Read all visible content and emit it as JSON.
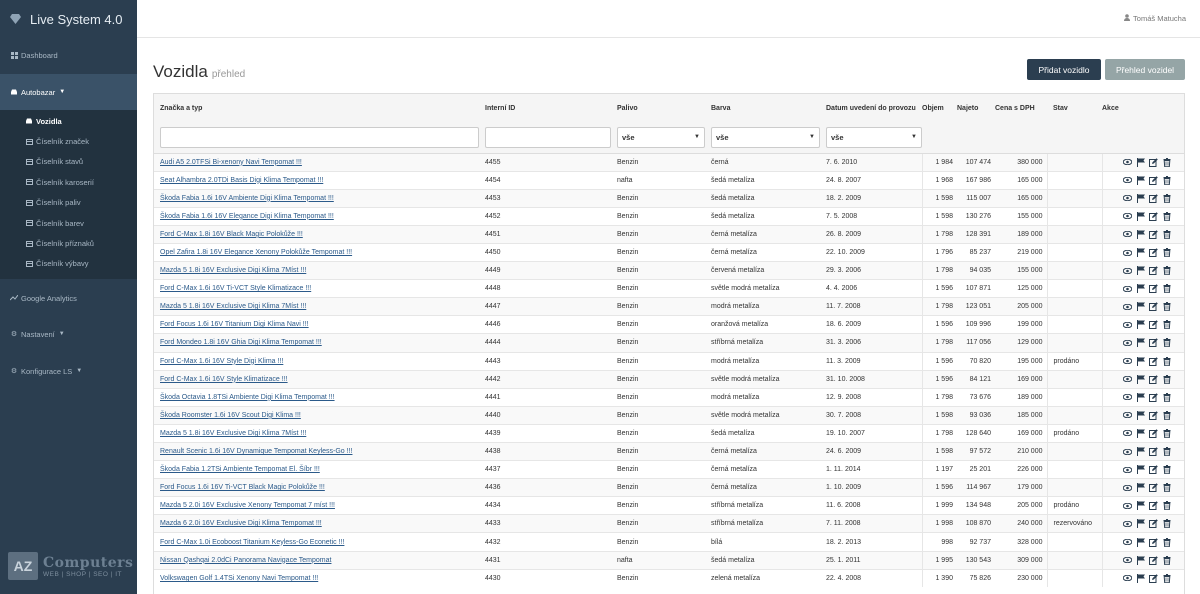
{
  "app": {
    "title": "Live System 4.0"
  },
  "sidebar": {
    "items": [
      {
        "label": "Dashboard",
        "icon": "dashboard-icon"
      },
      {
        "label": "Autobazar",
        "icon": "car-icon"
      },
      {
        "label": "Google Analytics",
        "icon": "chart-icon"
      },
      {
        "label": "Nastavení",
        "icon": "gears-icon"
      },
      {
        "label": "Konfigurace LS",
        "icon": "gear-icon"
      }
    ],
    "submenu": [
      {
        "label": "Vozidla",
        "icon": "car-icon"
      },
      {
        "label": "Číselník značek",
        "icon": "table-icon"
      },
      {
        "label": "Číselník stavů",
        "icon": "table-icon"
      },
      {
        "label": "Číselník karoserií",
        "icon": "table-icon"
      },
      {
        "label": "Číselník paliv",
        "icon": "table-icon"
      },
      {
        "label": "Číselník barev",
        "icon": "table-icon"
      },
      {
        "label": "Číselník příznaků",
        "icon": "table-icon"
      },
      {
        "label": "Číselník výbavy",
        "icon": "table-icon"
      }
    ],
    "logo": {
      "box": "AZ",
      "title": "Computers",
      "sub": "WEB | SHOP | SEO | IT"
    }
  },
  "topbar": {
    "user": "Tomáš Matucha"
  },
  "header": {
    "title": "Vozidla",
    "subtitle": "přehled",
    "add_label": "Přidat vozidlo",
    "view_label": "Přehled vozidel"
  },
  "table": {
    "columns": [
      "Značka a typ",
      "Interní ID",
      "Palivo",
      "Barva",
      "Datum uvedení do provozu",
      "Objem",
      "Najeto",
      "Cena s DPH",
      "Stav",
      "Akce"
    ],
    "filters": {
      "palivo": "vše",
      "barva": "vše",
      "datum": "vše"
    },
    "rows": [
      [
        "Audi A5 2.0TFSi Bi-xenony Navi Tempomat !!!",
        "4455",
        "Benzin",
        "černá",
        "7. 6. 2010",
        "1 984",
        "107 474",
        "380 000",
        ""
      ],
      [
        "Seat Alhambra 2.0TDi Basis Digi Klima Tempomat !!!",
        "4454",
        "nafta",
        "šedá metalíza",
        "24. 8. 2007",
        "1 968",
        "167 986",
        "165 000",
        ""
      ],
      [
        "Škoda Fabia 1.6i 16V Ambiente Digi Klima Tempomat !!!",
        "4453",
        "Benzin",
        "šedá metalíza",
        "18. 2. 2009",
        "1 598",
        "115 007",
        "165 000",
        ""
      ],
      [
        "Škoda Fabia 1.6i 16V Elegance Digi Klima Tempomat !!!",
        "4452",
        "Benzin",
        "šedá metalíza",
        "7. 5. 2008",
        "1 598",
        "130 276",
        "155 000",
        ""
      ],
      [
        "Ford C-Max 1.8i 16V Black Magic Polokůže !!!",
        "4451",
        "Benzin",
        "černá metalíza",
        "26. 8. 2009",
        "1 798",
        "128 391",
        "189 000",
        ""
      ],
      [
        "Opel Zafira 1.8i 16V Elegance Xenony Polokůže Tempomat !!!",
        "4450",
        "Benzin",
        "černá metalíza",
        "22. 10. 2009",
        "1 796",
        "85 237",
        "219 000",
        ""
      ],
      [
        "Mazda 5 1.8i 16V Exclusive Digi Klima 7Míst !!!",
        "4449",
        "Benzin",
        "červená metalíza",
        "29. 3. 2006",
        "1 798",
        "94 035",
        "155 000",
        ""
      ],
      [
        "Ford C-Max 1.6i 16V Ti-VCT Style Klimatizace !!!",
        "4448",
        "Benzin",
        "světle modrá metalíza",
        "4. 4. 2006",
        "1 596",
        "107 871",
        "125 000",
        ""
      ],
      [
        "Mazda 5 1.8i 16V Exclusive Digi Klima 7Míst !!!",
        "4447",
        "Benzin",
        "modrá metalíza",
        "11. 7. 2008",
        "1 798",
        "123 051",
        "205 000",
        ""
      ],
      [
        "Ford Focus 1.6i 16V Titanium Digi Klima Navi !!!",
        "4446",
        "Benzin",
        "oranžová metalíza",
        "18. 6. 2009",
        "1 596",
        "109 996",
        "199 000",
        ""
      ],
      [
        "Ford Mondeo 1.8i 16V Ghia Digi Klima Tempomat !!!",
        "4444",
        "Benzin",
        "stříbrná metalíza",
        "31. 3. 2006",
        "1 798",
        "117 056",
        "129 000",
        ""
      ],
      [
        "Ford C-Max 1.6i 16V Style Digi Klima !!!",
        "4443",
        "Benzin",
        "modrá metalíza",
        "11. 3. 2009",
        "1 596",
        "70 820",
        "195 000",
        "prodáno"
      ],
      [
        "Ford C-Max 1.6i 16V Style Klimatizace !!!",
        "4442",
        "Benzin",
        "světle modrá metalíza",
        "31. 10. 2008",
        "1 596",
        "84 121",
        "169 000",
        ""
      ],
      [
        "Škoda Octavia 1.8TSi Ambiente Digi Klima Tempomat !!!",
        "4441",
        "Benzin",
        "modrá metalíza",
        "12. 9. 2008",
        "1 798",
        "73 676",
        "189 000",
        ""
      ],
      [
        "Škoda Roomster 1.6i 16V Scout Digi Klima !!!",
        "4440",
        "Benzin",
        "světle modrá metalíza",
        "30. 7. 2008",
        "1 598",
        "93 036",
        "185 000",
        ""
      ],
      [
        "Mazda 5 1.8i 16V Exclusive Digi Klima 7Míst !!!",
        "4439",
        "Benzin",
        "šedá metalíza",
        "19. 10. 2007",
        "1 798",
        "128 640",
        "169 000",
        "prodáno"
      ],
      [
        "Renault Scenic 1.6i 16V Dynamique Tempomat Keyless-Go !!!",
        "4438",
        "Benzin",
        "černá metalíza",
        "24. 6. 2009",
        "1 598",
        "97 572",
        "210 000",
        ""
      ],
      [
        "Škoda Fabia 1.2TSi Ambiente Tempomat El. Šíbr !!!",
        "4437",
        "Benzin",
        "černá metalíza",
        "1. 11. 2014",
        "1 197",
        "25 201",
        "226 000",
        ""
      ],
      [
        "Ford Focus 1.6i 16V Ti-VCT Black Magic Polokůže !!!",
        "4436",
        "Benzin",
        "černá metalíza",
        "1. 10. 2009",
        "1 596",
        "114 967",
        "179 000",
        ""
      ],
      [
        "Mazda 5 2.0i 16V Exclusive Xenony Tempomat 7 míst !!!",
        "4434",
        "Benzin",
        "stříbrná metalíza",
        "11. 6. 2008",
        "1 999",
        "134 948",
        "205 000",
        "prodáno"
      ],
      [
        "Mazda 6 2.0i 16V Exclusive Digi Klima Tempomat !!!",
        "4433",
        "Benzin",
        "stříbrná metalíza",
        "7. 11. 2008",
        "1 998",
        "108 870",
        "240 000",
        "rezervováno"
      ],
      [
        "Ford C-Max 1.0i Ecoboost Titanium Keyless-Go Econetic !!!",
        "4432",
        "Benzin",
        "bílá",
        "18. 2. 2013",
        "998",
        "92 737",
        "328 000",
        ""
      ],
      [
        "Nissan Qashqai 2.0dCi Panorama Navigace Tempomat",
        "4431",
        "nafta",
        "šedá metalíza",
        "25. 1. 2011",
        "1 995",
        "130 543",
        "309 000",
        ""
      ],
      [
        "Volkswagen Golf 1.4TSi Xenony Navi Tempomat !!!",
        "4430",
        "Benzin",
        "zelená metalíza",
        "22. 4. 2008",
        "1 390",
        "75 826",
        "230 000",
        ""
      ]
    ]
  },
  "colors": {
    "sidebar_bg": "#2b3e50",
    "link": "#2b5a8a",
    "action_icon": "#2b3e50"
  }
}
